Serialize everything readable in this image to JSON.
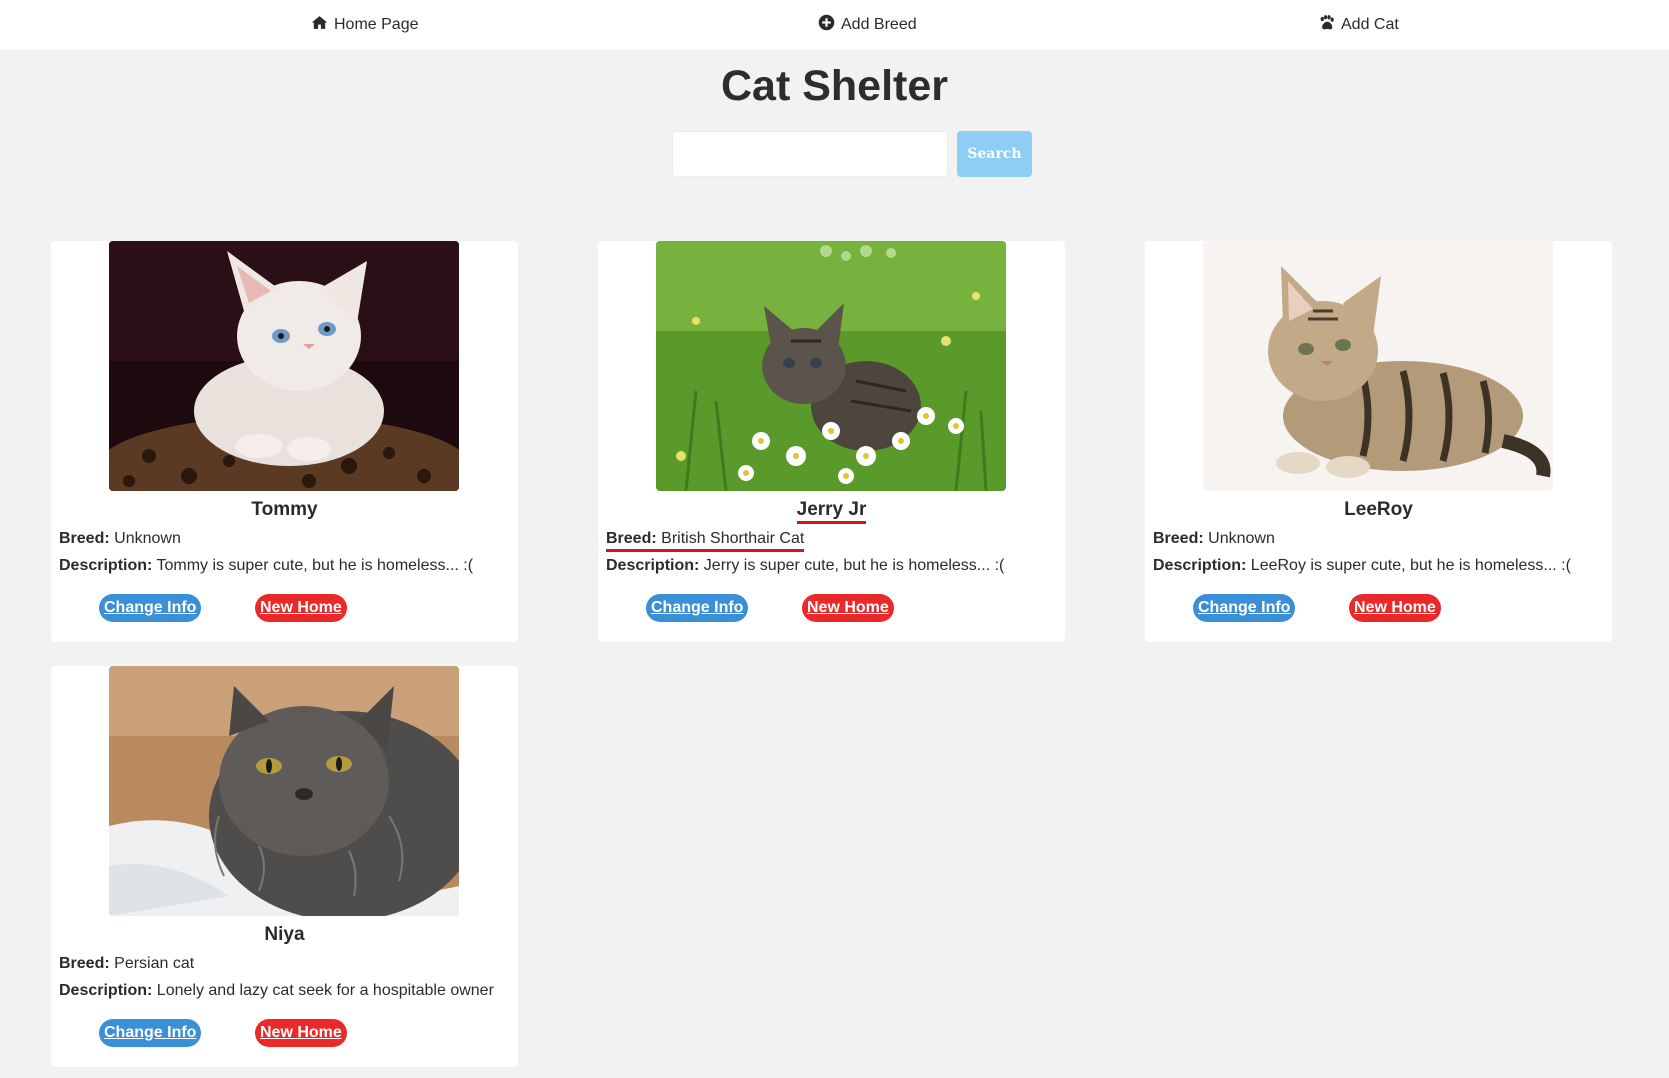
{
  "nav": {
    "home_label": "Home Page",
    "add_breed_label": "Add Breed",
    "add_cat_label": "Add Cat"
  },
  "header": {
    "title": "Cat Shelter",
    "search_placeholder": "",
    "search_value": "",
    "search_button": "Search"
  },
  "labels": {
    "breed": "Breed:",
    "description": "Description:",
    "change_info": "Change Info",
    "new_home": "New Home"
  },
  "colors": {
    "change_info_button": "#3a8fd6",
    "new_home_button": "#ea2a2a",
    "search_button": "#8ecdf6",
    "annotation_underline": "#d8141a"
  },
  "cats": [
    {
      "name": "Tommy",
      "breed": "Unknown",
      "description": "Tommy is super cute, but he is homeless... :(",
      "photo": "white-kitten-photo"
    },
    {
      "name": "Jerry Jr",
      "breed": "British Shorthair Cat",
      "description": "Jerry is super cute, but he is homeless... :(",
      "photo": "tabby-kitten-in-grass-photo"
    },
    {
      "name": "LeeRoy",
      "breed": "Unknown",
      "description": "LeeRoy is super cute, but he is homeless... :(",
      "photo": "striped-kitten-lying-photo"
    },
    {
      "name": "Niya",
      "breed": "Persian cat",
      "description": "Lonely and lazy cat seek for a hospitable owner",
      "photo": "gray-persian-cat-photo"
    }
  ]
}
